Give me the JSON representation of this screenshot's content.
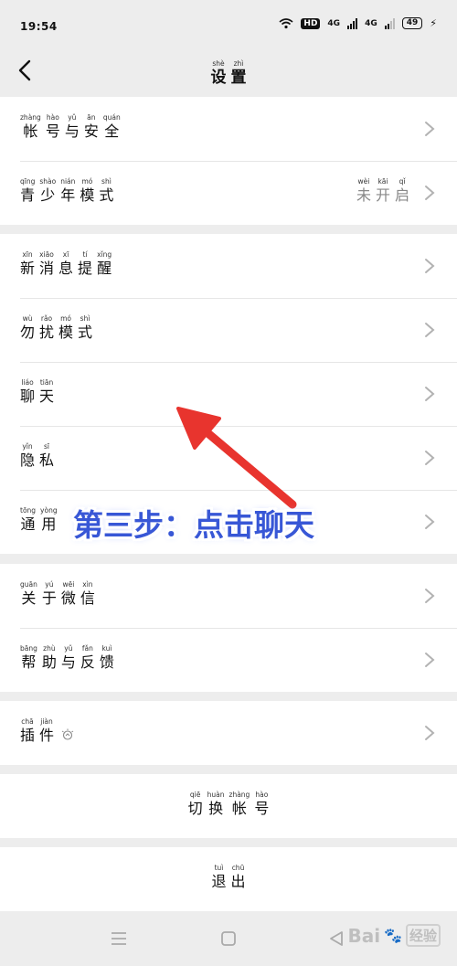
{
  "status_bar": {
    "time": "19:54",
    "hd": "HD",
    "network1": "4G",
    "network2": "4G",
    "battery": "49"
  },
  "header": {
    "title": [
      {
        "py": "shè",
        "hz": "设"
      },
      {
        "py": "zhì",
        "hz": "置"
      }
    ]
  },
  "groups": [
    {
      "rows": [
        {
          "id": "account-security",
          "label": [
            {
              "py": "zhàng",
              "hz": "帐"
            },
            {
              "py": "hào",
              "hz": "号"
            },
            {
              "py": "yǔ",
              "hz": "与"
            },
            {
              "py": "ān",
              "hz": "安"
            },
            {
              "py": "quán",
              "hz": "全"
            }
          ]
        },
        {
          "id": "youth-mode",
          "label": [
            {
              "py": "qīng",
              "hz": "青"
            },
            {
              "py": "shào",
              "hz": "少"
            },
            {
              "py": "nián",
              "hz": "年"
            },
            {
              "py": "mó",
              "hz": "模"
            },
            {
              "py": "shì",
              "hz": "式"
            }
          ],
          "value": [
            {
              "py": "wèi",
              "hz": "未"
            },
            {
              "py": "kāi",
              "hz": "开"
            },
            {
              "py": "qǐ",
              "hz": "启"
            }
          ]
        }
      ]
    },
    {
      "rows": [
        {
          "id": "new-message-alerts",
          "label": [
            {
              "py": "xīn",
              "hz": "新"
            },
            {
              "py": "xiāo",
              "hz": "消"
            },
            {
              "py": "xī",
              "hz": "息"
            },
            {
              "py": "tí",
              "hz": "提"
            },
            {
              "py": "xǐng",
              "hz": "醒"
            }
          ]
        },
        {
          "id": "do-not-disturb",
          "label": [
            {
              "py": "wù",
              "hz": "勿"
            },
            {
              "py": "rǎo",
              "hz": "扰"
            },
            {
              "py": "mó",
              "hz": "模"
            },
            {
              "py": "shì",
              "hz": "式"
            }
          ]
        },
        {
          "id": "chat",
          "label": [
            {
              "py": "liáo",
              "hz": "聊"
            },
            {
              "py": "tiān",
              "hz": "天"
            }
          ]
        },
        {
          "id": "privacy",
          "label": [
            {
              "py": "yǐn",
              "hz": "隐"
            },
            {
              "py": "sī",
              "hz": "私"
            }
          ]
        },
        {
          "id": "general",
          "label": [
            {
              "py": "tōng",
              "hz": "通"
            },
            {
              "py": "yòng",
              "hz": "用"
            }
          ]
        }
      ]
    },
    {
      "rows": [
        {
          "id": "about-wechat",
          "label": [
            {
              "py": "guān",
              "hz": "关"
            },
            {
              "py": "yú",
              "hz": "于"
            },
            {
              "py": "wēi",
              "hz": "微"
            },
            {
              "py": "xìn",
              "hz": "信"
            }
          ]
        },
        {
          "id": "help-feedback",
          "label": [
            {
              "py": "bāng",
              "hz": "帮"
            },
            {
              "py": "zhù",
              "hz": "助"
            },
            {
              "py": "yǔ",
              "hz": "与"
            },
            {
              "py": "fǎn",
              "hz": "反"
            },
            {
              "py": "kuì",
              "hz": "馈"
            }
          ]
        }
      ]
    },
    {
      "rows": [
        {
          "id": "plugins",
          "label": [
            {
              "py": "chā",
              "hz": "插"
            },
            {
              "py": "jiàn",
              "hz": "件"
            }
          ]
        }
      ]
    }
  ],
  "actions": {
    "switch_account": [
      {
        "py": "qiē",
        "hz": "切"
      },
      {
        "py": "huàn",
        "hz": "换"
      },
      {
        "py": "zhàng",
        "hz": "帐"
      },
      {
        "py": "hào",
        "hz": "号"
      }
    ],
    "log_out": [
      {
        "py": "tuì",
        "hz": "退"
      },
      {
        "py": "chū",
        "hz": "出"
      }
    ]
  },
  "annotation": {
    "text": "第三步：点击聊天",
    "color": "#3857d6",
    "arrow_color": "#e8342e"
  },
  "watermark": {
    "text": "Bai",
    "jy": "经验"
  },
  "icons": {
    "back": "chevron-left-icon",
    "row": "chevron-right-icon",
    "plugin": "lightbulb-icon",
    "nav_menu": "menu-icon",
    "nav_home": "home-square-icon",
    "nav_back": "back-triangle-icon"
  }
}
